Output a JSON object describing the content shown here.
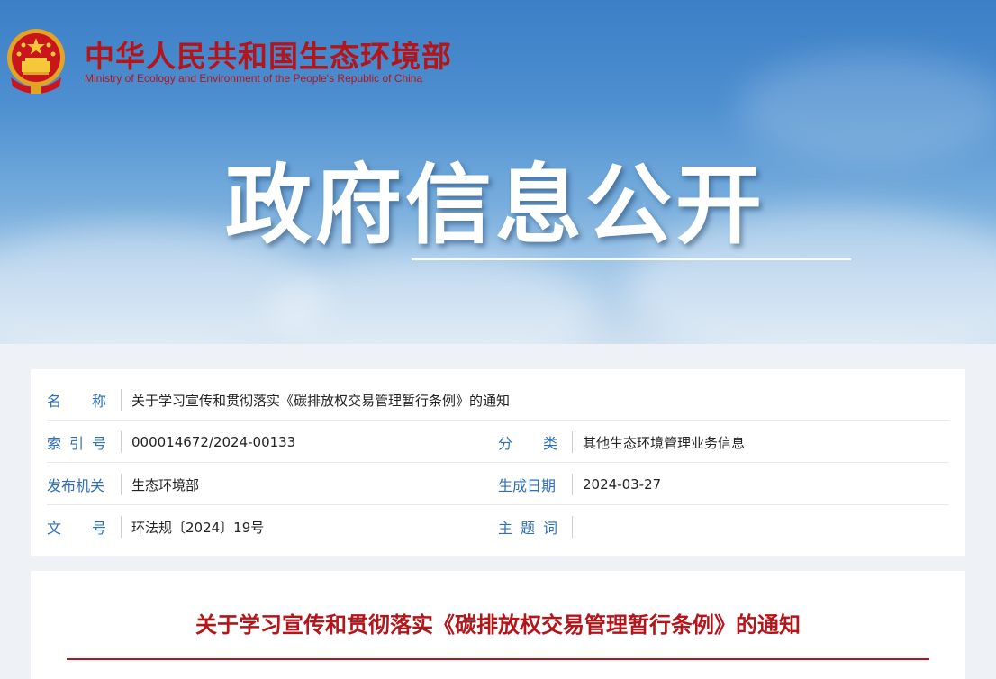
{
  "header": {
    "site_name_cn": "中华人民共和国生态环境部",
    "site_name_en": "Ministry of Ecology and Environment of the People's Republic of China",
    "page_title": "政府信息公开",
    "brand_color": "#b4151b"
  },
  "metadata": {
    "name_label": "名　　称",
    "name_value": "关于学习宣传和贯彻落实《碳排放权交易管理暂行条例》的通知",
    "index_label": "索 引 号",
    "index_value": "000014672/2024-00133",
    "category_label": "分　　类",
    "category_value": "其他生态环境管理业务信息",
    "issuer_label": "发布机关",
    "issuer_value": "生态环境部",
    "date_label": "生成日期",
    "date_value": "2024-03-27",
    "docno_label": "文　　号",
    "docno_value": "环法规〔2024〕19号",
    "keywords_label": "主 题 词",
    "keywords_value": ""
  },
  "document": {
    "title": "关于学习宣传和贯彻落实《碳排放权交易管理暂行条例》的通知"
  }
}
